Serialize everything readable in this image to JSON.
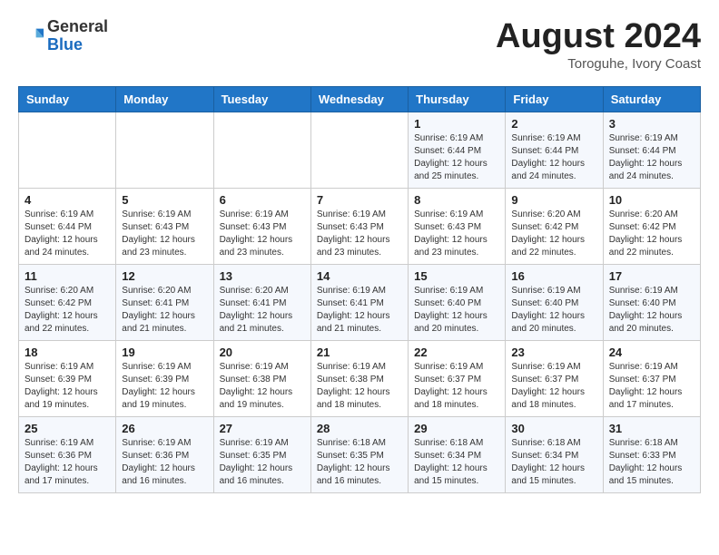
{
  "header": {
    "logo_general": "General",
    "logo_blue": "Blue",
    "main_title": "August 2024",
    "subtitle": "Toroguhe, Ivory Coast"
  },
  "calendar": {
    "days_of_week": [
      "Sunday",
      "Monday",
      "Tuesday",
      "Wednesday",
      "Thursday",
      "Friday",
      "Saturday"
    ],
    "weeks": [
      [
        {
          "day": "",
          "info": ""
        },
        {
          "day": "",
          "info": ""
        },
        {
          "day": "",
          "info": ""
        },
        {
          "day": "",
          "info": ""
        },
        {
          "day": "1",
          "info": "Sunrise: 6:19 AM\nSunset: 6:44 PM\nDaylight: 12 hours\nand 25 minutes."
        },
        {
          "day": "2",
          "info": "Sunrise: 6:19 AM\nSunset: 6:44 PM\nDaylight: 12 hours\nand 24 minutes."
        },
        {
          "day": "3",
          "info": "Sunrise: 6:19 AM\nSunset: 6:44 PM\nDaylight: 12 hours\nand 24 minutes."
        }
      ],
      [
        {
          "day": "4",
          "info": "Sunrise: 6:19 AM\nSunset: 6:44 PM\nDaylight: 12 hours\nand 24 minutes."
        },
        {
          "day": "5",
          "info": "Sunrise: 6:19 AM\nSunset: 6:43 PM\nDaylight: 12 hours\nand 23 minutes."
        },
        {
          "day": "6",
          "info": "Sunrise: 6:19 AM\nSunset: 6:43 PM\nDaylight: 12 hours\nand 23 minutes."
        },
        {
          "day": "7",
          "info": "Sunrise: 6:19 AM\nSunset: 6:43 PM\nDaylight: 12 hours\nand 23 minutes."
        },
        {
          "day": "8",
          "info": "Sunrise: 6:19 AM\nSunset: 6:43 PM\nDaylight: 12 hours\nand 23 minutes."
        },
        {
          "day": "9",
          "info": "Sunrise: 6:20 AM\nSunset: 6:42 PM\nDaylight: 12 hours\nand 22 minutes."
        },
        {
          "day": "10",
          "info": "Sunrise: 6:20 AM\nSunset: 6:42 PM\nDaylight: 12 hours\nand 22 minutes."
        }
      ],
      [
        {
          "day": "11",
          "info": "Sunrise: 6:20 AM\nSunset: 6:42 PM\nDaylight: 12 hours\nand 22 minutes."
        },
        {
          "day": "12",
          "info": "Sunrise: 6:20 AM\nSunset: 6:41 PM\nDaylight: 12 hours\nand 21 minutes."
        },
        {
          "day": "13",
          "info": "Sunrise: 6:20 AM\nSunset: 6:41 PM\nDaylight: 12 hours\nand 21 minutes."
        },
        {
          "day": "14",
          "info": "Sunrise: 6:19 AM\nSunset: 6:41 PM\nDaylight: 12 hours\nand 21 minutes."
        },
        {
          "day": "15",
          "info": "Sunrise: 6:19 AM\nSunset: 6:40 PM\nDaylight: 12 hours\nand 20 minutes."
        },
        {
          "day": "16",
          "info": "Sunrise: 6:19 AM\nSunset: 6:40 PM\nDaylight: 12 hours\nand 20 minutes."
        },
        {
          "day": "17",
          "info": "Sunrise: 6:19 AM\nSunset: 6:40 PM\nDaylight: 12 hours\nand 20 minutes."
        }
      ],
      [
        {
          "day": "18",
          "info": "Sunrise: 6:19 AM\nSunset: 6:39 PM\nDaylight: 12 hours\nand 19 minutes."
        },
        {
          "day": "19",
          "info": "Sunrise: 6:19 AM\nSunset: 6:39 PM\nDaylight: 12 hours\nand 19 minutes."
        },
        {
          "day": "20",
          "info": "Sunrise: 6:19 AM\nSunset: 6:38 PM\nDaylight: 12 hours\nand 19 minutes."
        },
        {
          "day": "21",
          "info": "Sunrise: 6:19 AM\nSunset: 6:38 PM\nDaylight: 12 hours\nand 18 minutes."
        },
        {
          "day": "22",
          "info": "Sunrise: 6:19 AM\nSunset: 6:37 PM\nDaylight: 12 hours\nand 18 minutes."
        },
        {
          "day": "23",
          "info": "Sunrise: 6:19 AM\nSunset: 6:37 PM\nDaylight: 12 hours\nand 18 minutes."
        },
        {
          "day": "24",
          "info": "Sunrise: 6:19 AM\nSunset: 6:37 PM\nDaylight: 12 hours\nand 17 minutes."
        }
      ],
      [
        {
          "day": "25",
          "info": "Sunrise: 6:19 AM\nSunset: 6:36 PM\nDaylight: 12 hours\nand 17 minutes."
        },
        {
          "day": "26",
          "info": "Sunrise: 6:19 AM\nSunset: 6:36 PM\nDaylight: 12 hours\nand 16 minutes."
        },
        {
          "day": "27",
          "info": "Sunrise: 6:19 AM\nSunset: 6:35 PM\nDaylight: 12 hours\nand 16 minutes."
        },
        {
          "day": "28",
          "info": "Sunrise: 6:18 AM\nSunset: 6:35 PM\nDaylight: 12 hours\nand 16 minutes."
        },
        {
          "day": "29",
          "info": "Sunrise: 6:18 AM\nSunset: 6:34 PM\nDaylight: 12 hours\nand 15 minutes."
        },
        {
          "day": "30",
          "info": "Sunrise: 6:18 AM\nSunset: 6:34 PM\nDaylight: 12 hours\nand 15 minutes."
        },
        {
          "day": "31",
          "info": "Sunrise: 6:18 AM\nSunset: 6:33 PM\nDaylight: 12 hours\nand 15 minutes."
        }
      ]
    ]
  }
}
